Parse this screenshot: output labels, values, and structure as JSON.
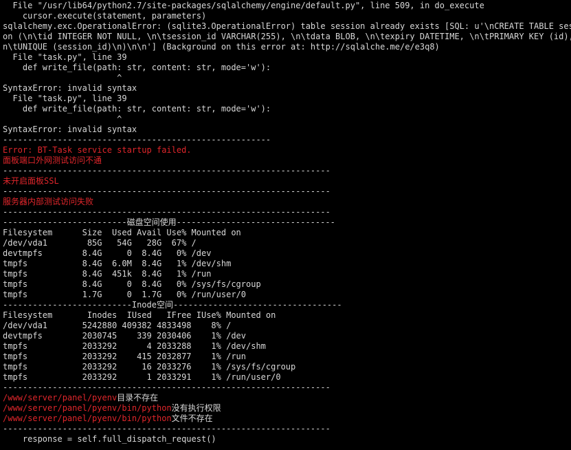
{
  "colors": {
    "background": "#000000",
    "text": "#d8d8d8",
    "error": "#e0262b"
  },
  "terminal": {
    "lines": [
      {
        "text": "  File \"/usr/lib64/python2.7/site-packages/sqlalchemy/engine/default.py\", line 509, in do_execute",
        "style": "white"
      },
      {
        "text": "    cursor.execute(statement, parameters)",
        "style": "white"
      },
      {
        "text": "sqlalchemy.exc.OperationalError: (sqlite3.OperationalError) table session already exists [SQL: u'\\nCREATE TABLE sessi",
        "style": "white"
      },
      {
        "text": "on (\\n\\tid INTEGER NOT NULL, \\n\\tsession_id VARCHAR(255), \\n\\tdata BLOB, \\n\\texpiry DATETIME, \\n\\tPRIMARY KEY (id), \\",
        "style": "white"
      },
      {
        "text": "n\\tUNIQUE (session_id)\\n)\\n\\n'] (Background on this error at: http://sqlalche.me/e/e3q8)",
        "style": "white"
      },
      {
        "text": "  File \"task.py\", line 39",
        "style": "white"
      },
      {
        "text": "    def write_file(path: str, content: str, mode='w'):",
        "style": "white"
      },
      {
        "text": "                       ^",
        "style": "white"
      },
      {
        "text": "SyntaxError: invalid syntax",
        "style": "white"
      },
      {
        "text": "  File \"task.py\", line 39",
        "style": "white"
      },
      {
        "text": "    def write_file(path: str, content: str, mode='w'):",
        "style": "white"
      },
      {
        "text": "                       ^",
        "style": "white"
      },
      {
        "text": "SyntaxError: invalid syntax",
        "style": "white"
      },
      {
        "text": "------------------------------------------------------",
        "style": "white"
      },
      {
        "text": "Error: BT-Task service startup failed.",
        "style": "red"
      },
      {
        "text": "面板端口外网测试访问不通",
        "style": "red"
      },
      {
        "text": "------------------------------------------------------------------",
        "style": "white"
      },
      {
        "text": "未开启面板SSL",
        "style": "red"
      },
      {
        "text": "------------------------------------------------------------------",
        "style": "white"
      },
      {
        "text": "服务器内部测试访问失败",
        "style": "red"
      },
      {
        "text": "------------------------------------------------------------------",
        "style": "white"
      },
      {
        "text": "-------------------------磁盘空间使用--------------------------------",
        "style": "white"
      },
      {
        "text": "Filesystem      Size  Used Avail Use% Mounted on",
        "style": "white"
      },
      {
        "text": "/dev/vda1        85G   54G   28G  67% /",
        "style": "white"
      },
      {
        "text": "devtmpfs        8.4G     0  8.4G   0% /dev",
        "style": "white"
      },
      {
        "text": "tmpfs           8.4G  6.0M  8.4G   1% /dev/shm",
        "style": "white"
      },
      {
        "text": "tmpfs           8.4G  451k  8.4G   1% /run",
        "style": "white"
      },
      {
        "text": "tmpfs           8.4G     0  8.4G   0% /sys/fs/cgroup",
        "style": "white"
      },
      {
        "text": "tmpfs           1.7G     0  1.7G   0% /run/user/0",
        "style": "white"
      },
      {
        "text": "--------------------------Inode空间----------------------------------",
        "style": "white"
      },
      {
        "text": "Filesystem       Inodes  IUsed   IFree IUse% Mounted on",
        "style": "white"
      },
      {
        "text": "/dev/vda1       5242880 409382 4833498    8% /",
        "style": "white"
      },
      {
        "text": "devtmpfs        2030745    339 2030406    1% /dev",
        "style": "white"
      },
      {
        "text": "tmpfs           2033292      4 2033288    1% /dev/shm",
        "style": "white"
      },
      {
        "text": "tmpfs           2033292    415 2032877    1% /run",
        "style": "white"
      },
      {
        "text": "tmpfs           2033292     16 2033276    1% /sys/fs/cgroup",
        "style": "white"
      },
      {
        "text": "tmpfs           2033292      1 2033291    1% /run/user/0",
        "style": "white"
      },
      {
        "text": "------------------------------------------------------------------",
        "style": "white"
      },
      {
        "segments": [
          {
            "text": "/www/server/panel/pyenv",
            "style": "red"
          },
          {
            "text": "目录不存在",
            "style": "white"
          }
        ]
      },
      {
        "segments": [
          {
            "text": "/www/server/panel/pyenv/bin/python",
            "style": "red"
          },
          {
            "text": "没有执行权限",
            "style": "white"
          }
        ]
      },
      {
        "segments": [
          {
            "text": "/www/server/panel/pyenv/bin/python",
            "style": "red"
          },
          {
            "text": "文件不存在",
            "style": "white"
          }
        ]
      },
      {
        "text": "------------------------------------------------------------------",
        "style": "white"
      },
      {
        "text": "    response = self.full_dispatch_request()",
        "style": "white"
      }
    ]
  }
}
